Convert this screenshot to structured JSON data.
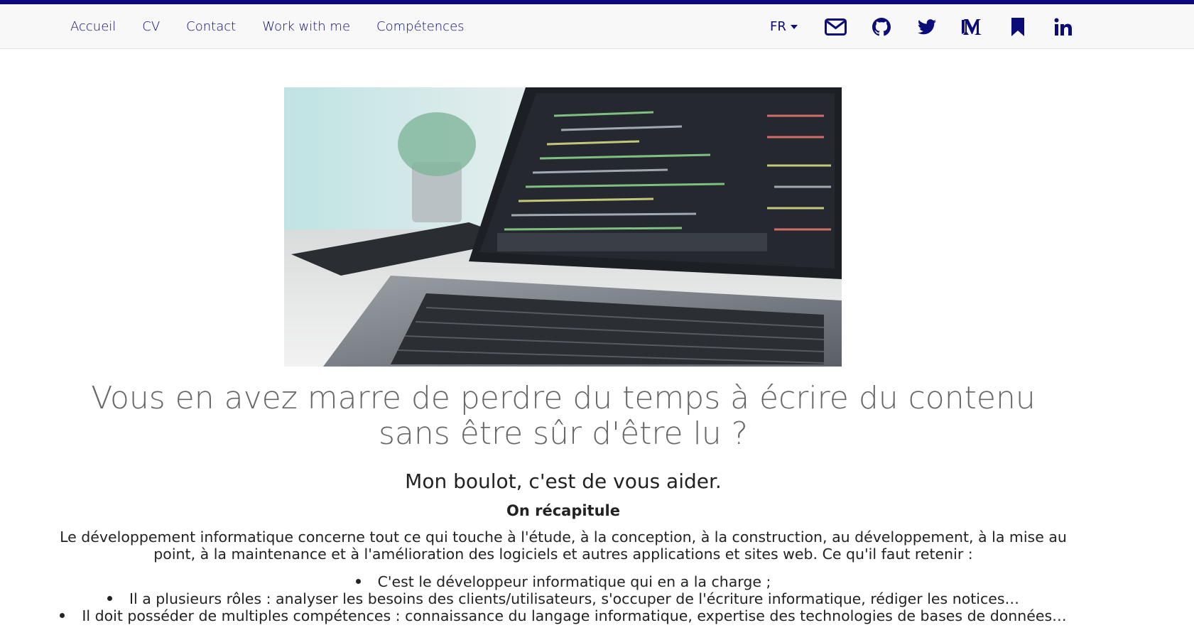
{
  "nav": {
    "links": [
      "Accueil",
      "CV",
      "Contact",
      "Work with me",
      "Compétences"
    ],
    "language": "FR",
    "social_icons": [
      "mail-icon",
      "github-icon",
      "twitter-icon",
      "medium-icon",
      "bookmark-icon",
      "linkedin-icon"
    ]
  },
  "hero": {
    "image": "laptop-code-photo"
  },
  "main": {
    "title": "Vous en avez marre de perdre du temps à écrire du contenu sans être sûr d'être lu ?",
    "subtitle": "Mon boulot, c'est de vous aider.",
    "section_heading": "On récapitule",
    "paragraph": "Le développement informatique concerne tout ce qui touche à l'étude, à la conception, à la construction, au développement, à la mise au point, à la maintenance et à l'amélioration des logiciels et autres applications et sites web. Ce qu'il faut retenir :",
    "bullets": [
      "C'est le développeur informatique qui en a la charge ;",
      "Il a plusieurs rôles : analyser les besoins des clients/utilisateurs, s'occuper de l'écriture informatique, rédiger les notices…",
      "Il doit posséder de multiples compétences : connaissance du langage informatique, expertise des technologies de bases de données…"
    ]
  },
  "colors": {
    "brand": "#0b0b7a",
    "title_text": "#666666",
    "body_text": "#222222"
  }
}
